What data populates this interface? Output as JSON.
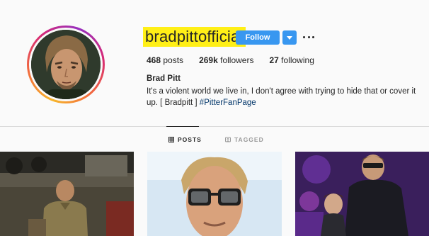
{
  "profile": {
    "username": "bradpittofficial",
    "follow_label": "Follow",
    "stats": [
      {
        "value": "468",
        "label": "posts"
      },
      {
        "value": "269k",
        "label": "followers"
      },
      {
        "value": "27",
        "label": "following"
      }
    ],
    "full_name": "Brad Pitt",
    "bio_text": "It's a violent world we live in, I don't agree with trying to hide that or cover it up. [ Bradpitt ] ",
    "bio_hashtag": "#PitterFanPage",
    "highlight_color": "#ffef16",
    "accent_color": "#3897f0"
  },
  "tabs": [
    {
      "label": "POSTS",
      "icon": "grid-icon",
      "active": true
    },
    {
      "label": "TAGGED",
      "icon": "tag-icon",
      "active": false
    }
  ],
  "posts": [
    {
      "icon": "photo-soldier-tank"
    },
    {
      "icon": "photo-sunglasses-portrait"
    },
    {
      "icon": "photo-event-purple"
    }
  ]
}
